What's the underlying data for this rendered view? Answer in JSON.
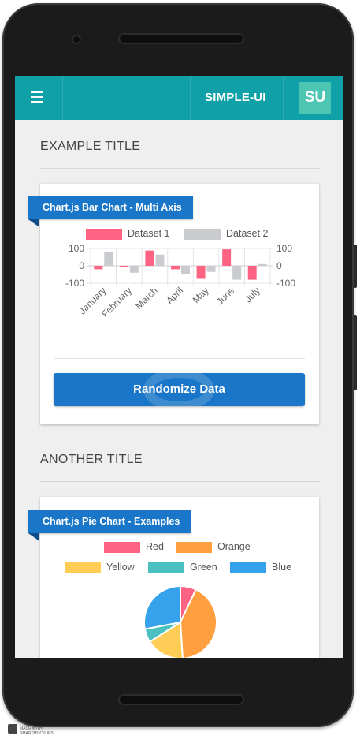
{
  "appbar": {
    "title": "SIMPLE-UI",
    "avatar_initials": "SU"
  },
  "sections": [
    {
      "title": "EXAMPLE TITLE"
    },
    {
      "title": "ANOTHER TITLE"
    }
  ],
  "bar_card": {
    "ribbon": "Chart.js Bar Chart - Multi Axis",
    "button_label": "Randomize Data"
  },
  "pie_card": {
    "ribbon": "Chart.js Pie Chart - Examples"
  },
  "watermark": {
    "line1": "MADE WITH",
    "line2": "SMARTMOCKUPS"
  },
  "chart_data": [
    {
      "type": "bar",
      "categories": [
        "January",
        "February",
        "March",
        "April",
        "May",
        "June",
        "July"
      ],
      "series": [
        {
          "name": "Dataset 1",
          "color": "#ff6384",
          "values": [
            -20,
            -8,
            88,
            -20,
            -75,
            95,
            -80
          ]
        },
        {
          "name": "Dataset 2",
          "color": "#c9cbcf",
          "values": [
            82,
            -40,
            65,
            -50,
            -35,
            -80,
            10
          ]
        }
      ],
      "ylim": [
        -100,
        100
      ],
      "yticks": [
        100,
        0,
        -100
      ],
      "ytick_labels": [
        "100",
        "0",
        "-100"
      ],
      "legend": "top"
    },
    {
      "type": "pie",
      "slices": [
        {
          "label": "Red",
          "value": 7,
          "color": "#ff6384"
        },
        {
          "label": "Orange",
          "value": 42,
          "color": "#ff9f40"
        },
        {
          "label": "Yellow",
          "value": 17,
          "color": "#ffcd56"
        },
        {
          "label": "Green",
          "value": 6,
          "color": "#4bc0c0"
        },
        {
          "label": "Blue",
          "value": 28,
          "color": "#36a2eb"
        }
      ],
      "legend": "top"
    }
  ]
}
